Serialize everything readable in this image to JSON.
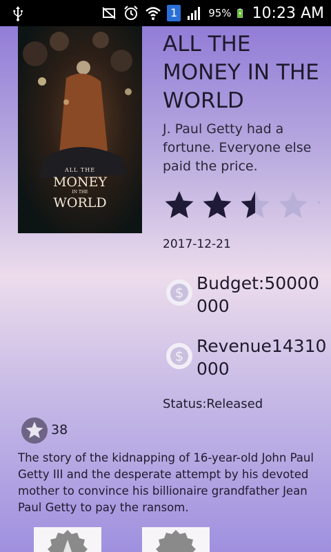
{
  "status_bar": {
    "battery": "95%",
    "time": "10:23 AM",
    "notification": "1",
    "icons": [
      "usb-icon",
      "mute-icon",
      "alarm-icon",
      "wifi-icon",
      "sim-icon",
      "signal-icon",
      "battery-icon"
    ]
  },
  "movie": {
    "poster": {
      "line1": "ALL THE",
      "line2": "MONEY",
      "line3": "IN THE",
      "line4": "WORLD"
    },
    "title": "ALL THE MONEY IN THE WORLD",
    "tagline": "J. Paul Getty had a fortune. Everyone else paid the price.",
    "rating": {
      "filled": 2.5,
      "max": 5
    },
    "release_date": "2017-12-21",
    "budget": "Budget:50000000",
    "revenue": "Revenue14310000",
    "status": "Status:Released",
    "vote_count": "38",
    "overview": "The story of the kidnapping of 16-year-old John Paul Getty III and the desperate attempt by his devoted mother to convince his billionaire grandfather Jean Paul Getty to pay the ransom."
  },
  "colors": {
    "star_filled": "#1f1a36",
    "star_empty": "#b9b0d8",
    "text": "#1e1a2c"
  }
}
